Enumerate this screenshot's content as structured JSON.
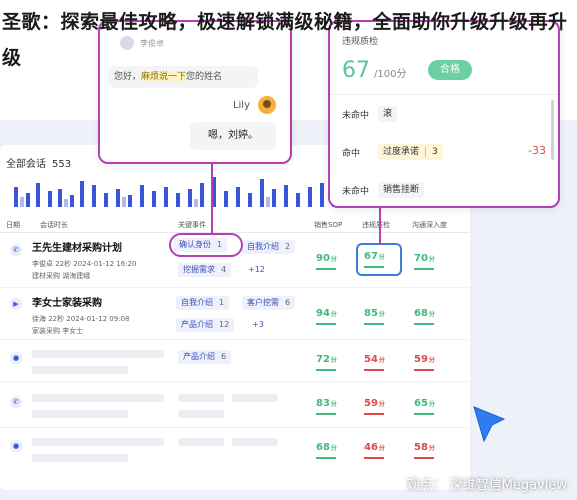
{
  "headline": "圣歌：探索最佳攻略，极速解锁满级秘籍，全面助你升级升级再升级",
  "dashboard": {
    "title": "全部会话",
    "count": "553",
    "headers": [
      "日期",
      "会话时长",
      "关键事件",
      "销售SOP",
      "违规质检",
      "沟通深入度"
    ],
    "rows": [
      {
        "title": "王先生建材采购计划",
        "meta1": "李俊卓  22秒  2024-01-12 16:20",
        "meta2": "建材采购  湖海建峨",
        "tags": [
          {
            "label": "确认身份",
            "n": "1"
          },
          {
            "label": "自我介绍",
            "n": "2"
          },
          {
            "label": "挖掘需求",
            "n": "4"
          }
        ],
        "plus": "+12",
        "scores": [
          "90",
          "67",
          "70"
        ],
        "unit": "分"
      },
      {
        "title": "李女士家装采购",
        "meta1": "徐海  22秒  2024-01-12 09:08",
        "meta2": "家装采购  李女士",
        "tags": [
          {
            "label": "自我介绍",
            "n": "1"
          },
          {
            "label": "客户挖需",
            "n": "6"
          },
          {
            "label": "产品介绍",
            "n": "12"
          }
        ],
        "plus": "+3",
        "scores": [
          "94",
          "85",
          "68"
        ],
        "unit": "分"
      },
      {
        "tags": [
          {
            "label": "产品介绍",
            "n": "6"
          }
        ],
        "scores": [
          "72",
          "54",
          "59"
        ],
        "unit": "分"
      },
      {
        "scores": [
          "83",
          "59",
          "65"
        ],
        "unit": "分"
      },
      {
        "scores": [
          "68",
          "46",
          "58"
        ],
        "unit": "分"
      }
    ]
  },
  "chat": {
    "agent_name": "李俊卓",
    "msg_prefix": "您好，",
    "msg_highlight": "麻烦说一下",
    "msg_suffix": "您的姓名",
    "customer_name": "Lily",
    "reply": "嗯，刘婷。"
  },
  "quality": {
    "title": "违规质检",
    "score": "67",
    "max": "/100分",
    "badge": "合格",
    "items": [
      {
        "status": "未命中",
        "label": "滚",
        "n": ""
      },
      {
        "status": "命中",
        "label": "过度承诺",
        "n": "3"
      },
      {
        "status": "未命中",
        "label": "销售挂断",
        "n": ""
      }
    ],
    "penalty": "-33"
  },
  "colors": {
    "accent": "#b53fb3",
    "blue": "#3a7fd8",
    "green": "#3fb97d",
    "red": "#e04848"
  },
  "watermark": "观点： 深维智信Megaview"
}
